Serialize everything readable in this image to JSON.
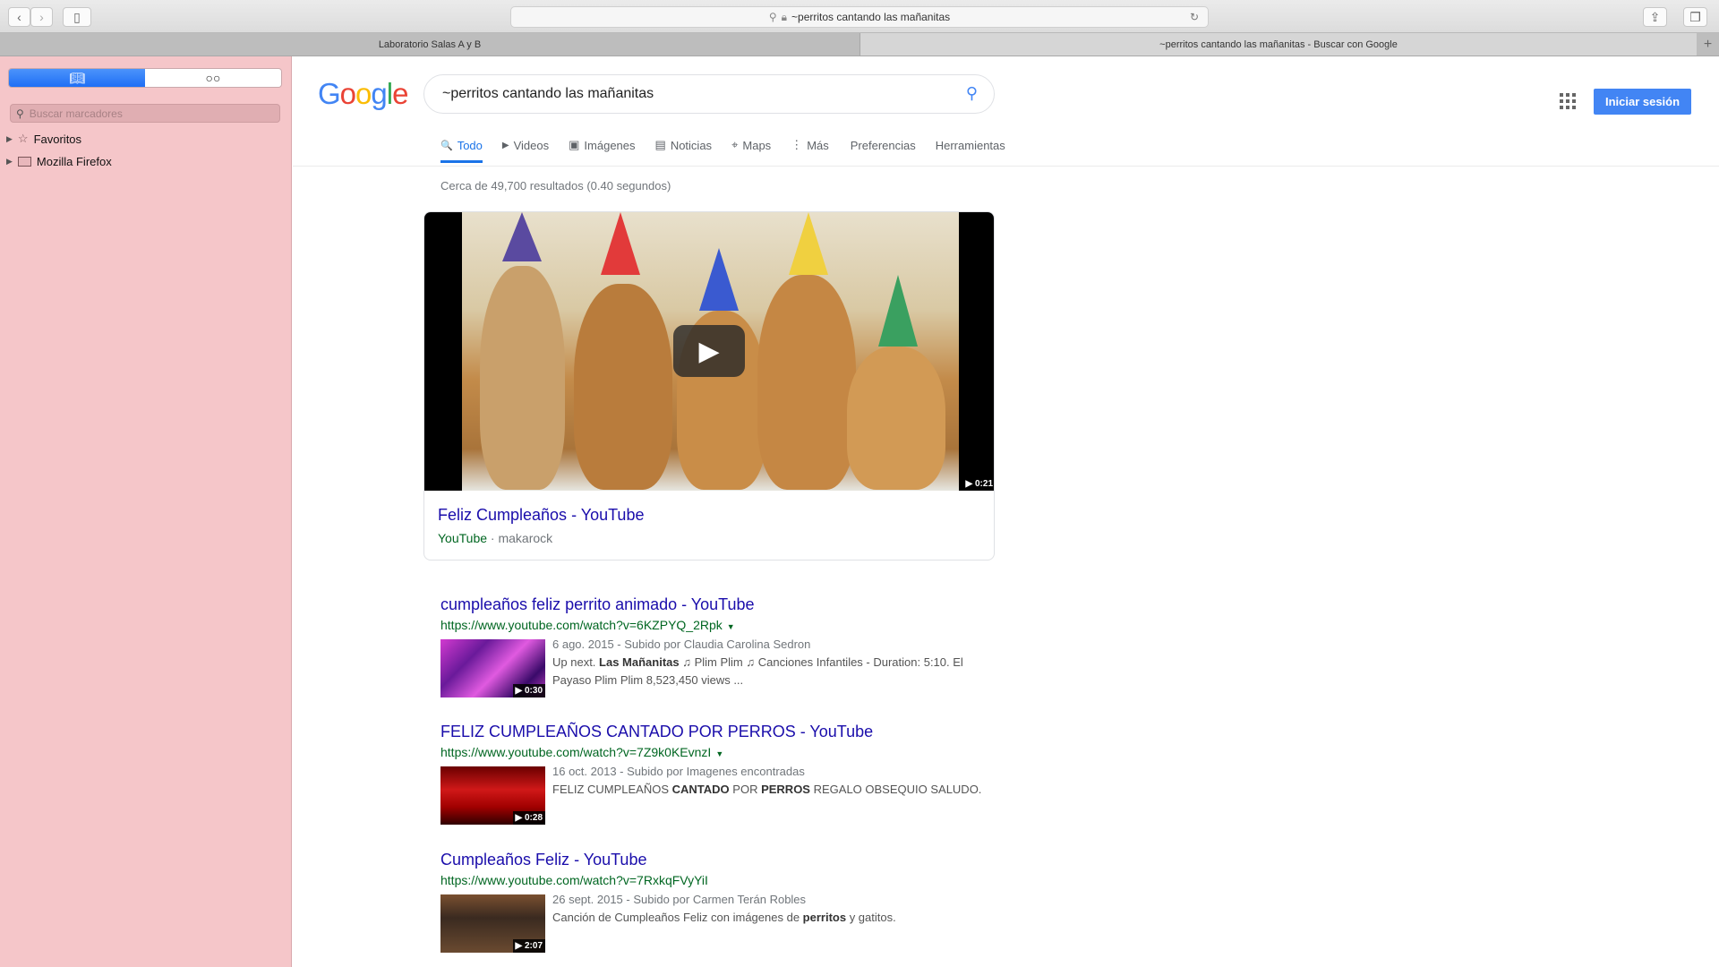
{
  "browser": {
    "address": "~perritos cantando las mañanitas",
    "tabs": [
      {
        "label": "Laboratorio Salas A y B",
        "active": false
      },
      {
        "label": "~perritos cantando las mañanitas - Buscar con Google",
        "active": true
      }
    ],
    "new_tab": "+"
  },
  "sidebar": {
    "search_placeholder": "Buscar marcadores",
    "items": [
      {
        "label": "Favoritos",
        "icon": "star-icon"
      },
      {
        "label": "Mozilla Firefox",
        "icon": "folder-icon"
      }
    ]
  },
  "google": {
    "logo": "Google",
    "query": "~perritos cantando las mañanitas",
    "signin": "Iniciar sesión",
    "tabs": [
      {
        "label": "Todo",
        "icon": "🔍"
      },
      {
        "label": "Videos",
        "icon": "▶"
      },
      {
        "label": "Imágenes",
        "icon": "▣"
      },
      {
        "label": "Noticias",
        "icon": "▤"
      },
      {
        "label": "Maps",
        "icon": "⌖"
      },
      {
        "label": "Más",
        "icon": "⋮"
      },
      {
        "label": "Preferencias",
        "icon": ""
      },
      {
        "label": "Herramientas",
        "icon": ""
      }
    ],
    "stats": "Cerca de 49,700 resultados (0.40 segundos)",
    "video_card": {
      "title": "Feliz Cumpleaños - YouTube",
      "source": "YouTube",
      "author": "· makarock",
      "duration": "▶ 0:21"
    },
    "results": [
      {
        "title": "cumpleaños feliz perrito animado - YouTube",
        "url": "https://www.youtube.com/watch?v=6KZPYQ_2Rpk",
        "caret": "▼",
        "duration": "▶ 0:30",
        "date": "6 ago. 2015 - Subido por Claudia Carolina Sedron",
        "snippet": [
          {
            "t": "Up next. ",
            "b": false
          },
          {
            "t": "Las Mañanitas",
            "b": true
          },
          {
            "t": " ♫ Plim Plim ♫ Canciones Infantiles - Duration: 5:10. El Payaso Plim Plim 8,523,450 views ...",
            "b": false
          }
        ]
      },
      {
        "title": "FELIZ CUMPLEAÑOS CANTADO POR PERROS - YouTube",
        "url": "https://www.youtube.com/watch?v=7Z9k0KEvnzI",
        "caret": "▼",
        "duration": "▶ 0:28",
        "date": "16 oct. 2013 - Subido por Imagenes encontradas",
        "snippet": [
          {
            "t": "FELIZ CUMPLEAÑOS ",
            "b": false
          },
          {
            "t": "CANTADO",
            "b": true
          },
          {
            "t": " POR ",
            "b": false
          },
          {
            "t": "PERROS",
            "b": true
          },
          {
            "t": " REGALO OBSEQUIO SALUDO.",
            "b": false
          }
        ]
      },
      {
        "title": "Cumpleaños Feliz - YouTube",
        "url": "https://www.youtube.com/watch?v=7RxkqFVyYiI",
        "caret": "",
        "duration": "▶ 2:07",
        "date": "26 sept. 2015 - Subido por Carmen Terán Robles",
        "snippet": [
          {
            "t": "Canción de Cumpleaños Feliz con imágenes de ",
            "b": false
          },
          {
            "t": "perritos",
            "b": true
          },
          {
            "t": " y gatitos.",
            "b": false
          }
        ]
      }
    ]
  }
}
